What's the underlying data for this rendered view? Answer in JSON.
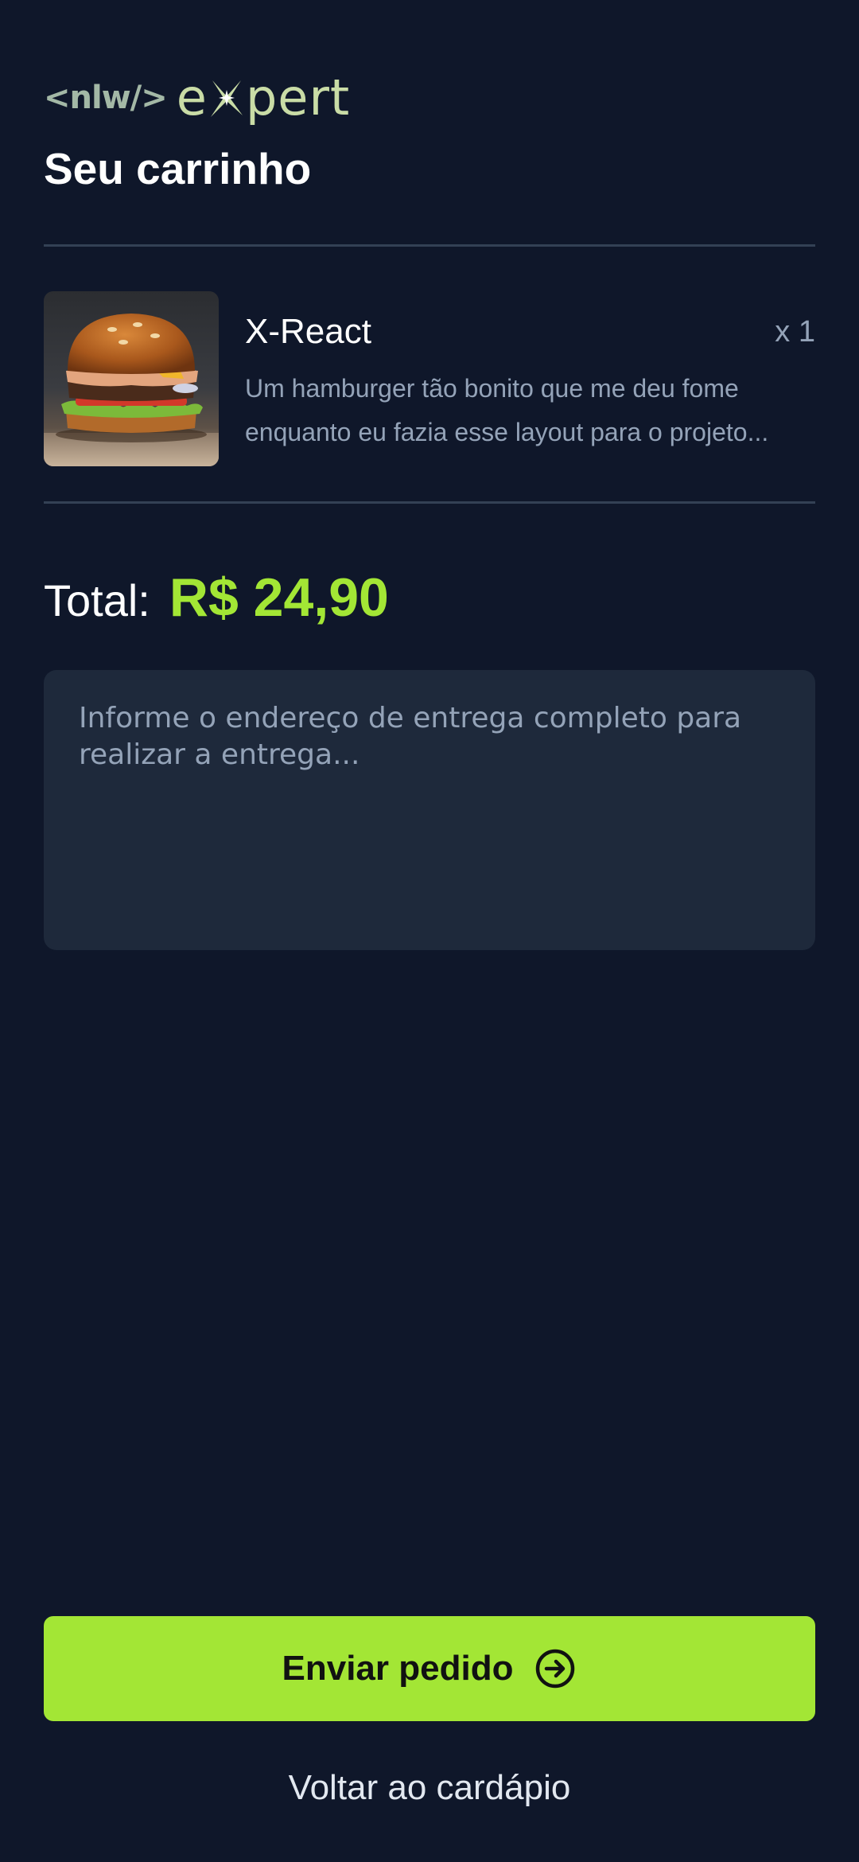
{
  "logo": {
    "prefix": "<nlw/>",
    "wordmark_start": "e",
    "wordmark_end": "pert",
    "mark_icon": "sparkle-x-icon"
  },
  "header": {
    "title": "Seu carrinho"
  },
  "cart": {
    "items": [
      {
        "name": "X-React",
        "quantity": "x 1",
        "description": "Um hamburger tão bonito que me deu fome enquanto eu fazia esse layout para o projeto...",
        "image_icon": "burger-photo"
      }
    ]
  },
  "total": {
    "label": "Total:",
    "value": "R$ 24,90"
  },
  "address": {
    "placeholder": "Informe o endereço de entrega completo para realizar a entrega...",
    "value": ""
  },
  "actions": {
    "send_label": "Enviar pedido",
    "send_icon": "arrow-right-circle-icon",
    "back_label": "Voltar ao cardápio"
  },
  "colors": {
    "background": "#0f172a",
    "surface": "#1e293b",
    "divider": "#334155",
    "accent": "#a3e635",
    "muted_text": "#94a3b8"
  }
}
